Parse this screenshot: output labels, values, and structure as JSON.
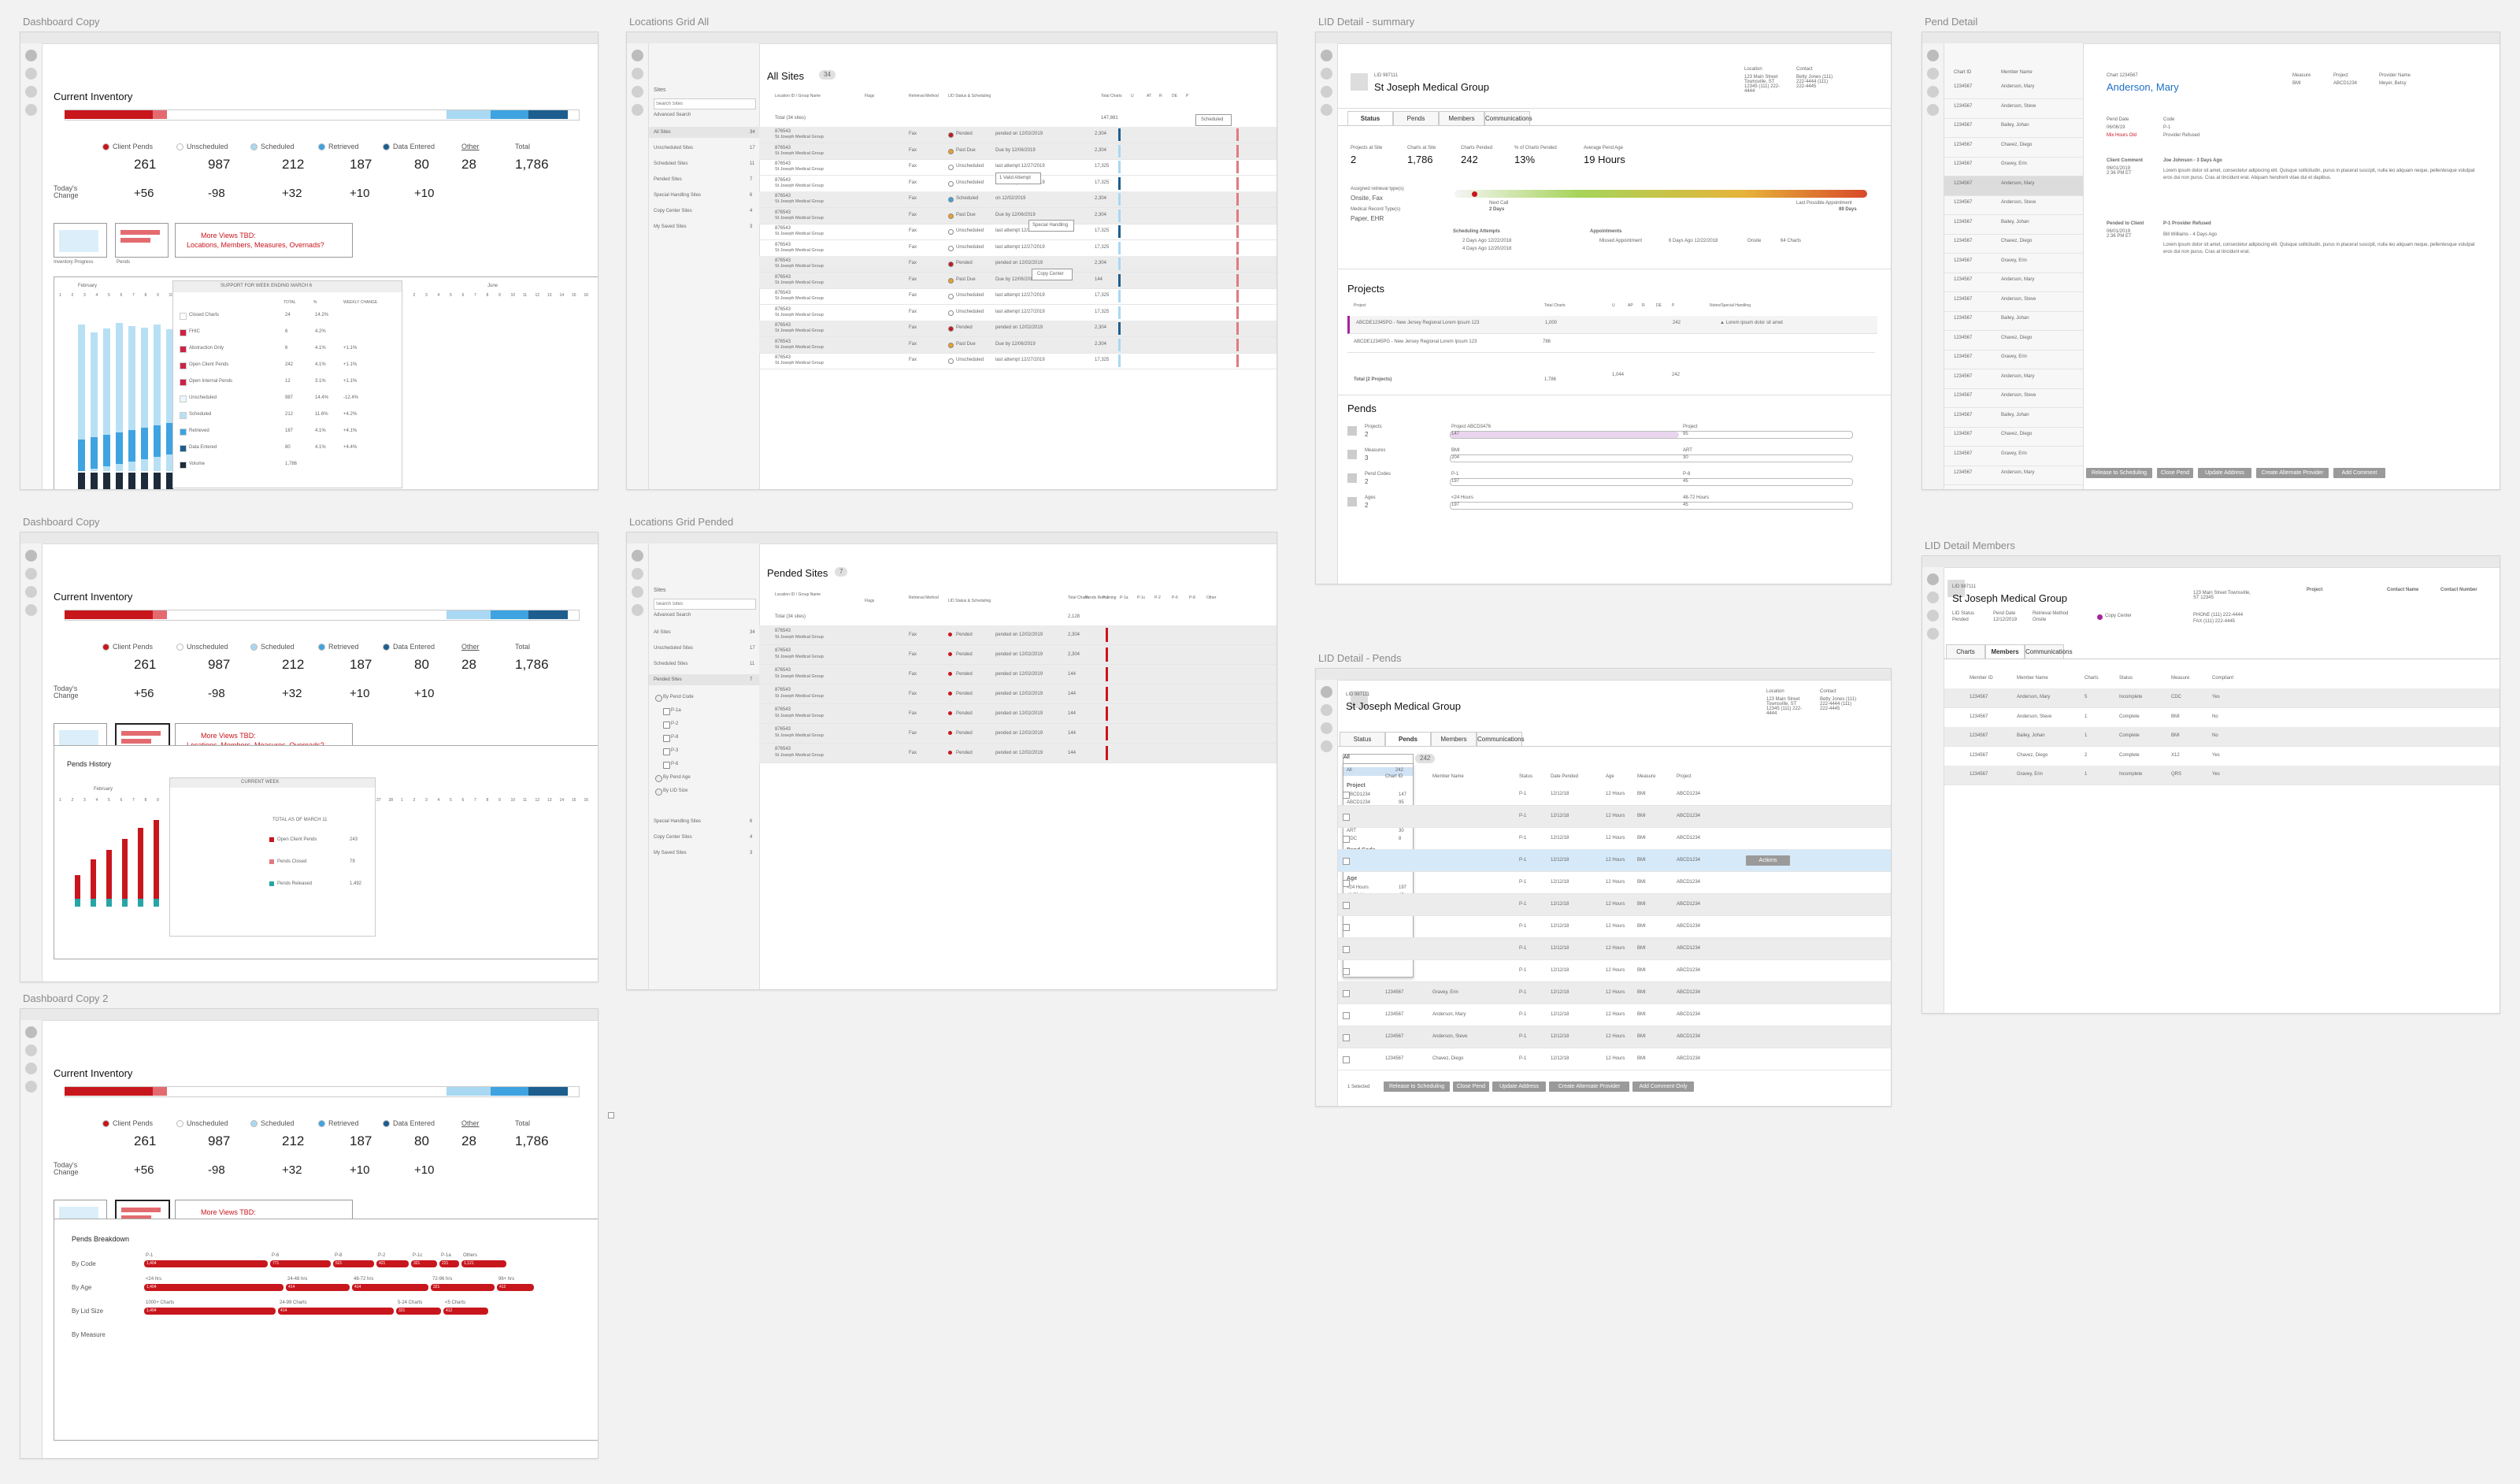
{
  "artboards": {
    "dash1": "Dashboard Copy",
    "locations_all": "Locations Grid All",
    "lid_summary": "LID Detail - summary",
    "pend_detail": "Pend Detail",
    "dash2": "Dashboard Copy",
    "locations_pended": "Locations Grid Pended",
    "lid_pends": "LID Detail - Pends",
    "lid_members": "LID Detail Members",
    "dash3": "Dashboard Copy 2"
  },
  "inventory": {
    "title": "Current Inventory",
    "legend": [
      {
        "label": "Client Pends",
        "color": "#c8161d",
        "value": "261",
        "change": "+56"
      },
      {
        "label": "Unscheduled",
        "color": "#ffffff",
        "value": "987",
        "change": "-98"
      },
      {
        "label": "Scheduled",
        "color": "#a9d8f2",
        "value": "212",
        "change": "+32"
      },
      {
        "label": "Retrieved",
        "color": "#3ea3e0",
        "value": "187",
        "change": "+10"
      },
      {
        "label": "Data Entered",
        "color": "#1d5e8f",
        "value": "80",
        "change": "+10"
      }
    ],
    "other_label": "Other",
    "other_value": "28",
    "total_label": "Total",
    "total_value": "1,786",
    "today_change_label": "Today's Change",
    "more_views": "More Views TBD:",
    "more_views_sub": "Locations, Members, Measures, Overnads?",
    "thumb1": "Inventory Progress",
    "thumb2": "Pends"
  },
  "dash1_chart": {
    "header": "SUPPORT FOR WEEK ENDING MARCH 6",
    "months": [
      "February",
      "March",
      "April",
      "May",
      "June"
    ],
    "cols": [
      "TOTAL",
      "%",
      "WEEKLY CHANGE"
    ],
    "rows": [
      {
        "label": "Closed Charts",
        "total": "24",
        "pct": "14.2%",
        "chg": ""
      },
      {
        "label": "FHIC",
        "total": "6",
        "pct": "4.2%",
        "chg": ""
      },
      {
        "label": "Abstraction Only",
        "total": "6",
        "pct": "4.1%",
        "chg": "+1.1%"
      },
      {
        "label": "Open Client Pends",
        "total": "242",
        "pct": "4.1%",
        "chg": "+1.1%"
      },
      {
        "label": "Open Internal Pends",
        "total": "12",
        "pct": "3.1%",
        "chg": "+1.1%"
      },
      {
        "label": "Unscheduled",
        "total": "987",
        "pct": "14.4%",
        "chg": "-12.4%"
      },
      {
        "label": "Scheduled",
        "total": "212",
        "pct": "11.6%",
        "chg": "+4.2%"
      },
      {
        "label": "Retrieved",
        "total": "187",
        "pct": "4.1%",
        "chg": "+4.1%"
      },
      {
        "label": "Data Entered",
        "total": "80",
        "pct": "4.1%",
        "chg": "+4.4%"
      },
      {
        "label": "Volume",
        "total": "1,786",
        "pct": "",
        "chg": ""
      }
    ]
  },
  "pends_history": {
    "title": "Pends History",
    "current_week": "CURRENT WEEK",
    "total_label": "TOTAL AS OF MARCH 11",
    "items": [
      {
        "label": "Open Client Pends",
        "value": "243",
        "color": "#c8161d"
      },
      {
        "label": "Pends Closed",
        "value": "79",
        "color": "#e07b80"
      },
      {
        "label": "Pends Released",
        "value": "1,492",
        "color": "#27a5a5"
      }
    ],
    "month": "February"
  },
  "pends_breakdown": {
    "title": "Pends Breakdown",
    "rows": [
      {
        "label": "By Code",
        "segs": [
          {
            "h": "P-1",
            "v": "1,404"
          },
          {
            "h": "P-6",
            "v": "771"
          },
          {
            "h": "P-8",
            "v": "521"
          },
          {
            "h": "P-2",
            "v": "421"
          },
          {
            "h": "P-1c",
            "v": "321"
          },
          {
            "h": "P-1a",
            "v": "221"
          },
          {
            "h": "Others",
            "v": "1,121"
          }
        ]
      },
      {
        "label": "By Age",
        "segs": [
          {
            "h": "<24 hrs",
            "v": "1,404"
          },
          {
            "h": "24-48 hrs",
            "v": "414"
          },
          {
            "h": "48-72 hrs",
            "v": "414"
          },
          {
            "h": "72-96 hrs",
            "v": "321"
          },
          {
            "h": "96+ hrs",
            "v": "412"
          }
        ]
      },
      {
        "label": "By Lid Size",
        "segs": [
          {
            "h": "1000+ Charts",
            "v": "1,404"
          },
          {
            "h": "24-99 Charts",
            "v": "414"
          },
          {
            "h": "5-24 Charts",
            "v": "321"
          },
          {
            "h": "<5 Charts",
            "v": "412"
          }
        ]
      },
      {
        "label": "By Measure",
        "segs": []
      }
    ]
  },
  "locations": {
    "sites_label": "Sites",
    "search_placeholder": "Search Sites",
    "advanced_search": "Advanced Search",
    "all_sites_title": "All Sites",
    "all_sites_count": "34",
    "pended_title": "Pended Sites",
    "pended_count": "7",
    "sidebar": [
      {
        "label": "All Sites",
        "count": "34"
      },
      {
        "label": "Unscheduled Sites",
        "count": "17"
      },
      {
        "label": "Scheduled Sites",
        "count": "11"
      },
      {
        "label": "Pended Sites",
        "count": "7"
      },
      {
        "label": "Special Handling Sites",
        "count": "6"
      },
      {
        "label": "Copy Center Sites",
        "count": "4"
      },
      {
        "label": "My Saved Sites",
        "count": "3"
      }
    ],
    "pend_filters": [
      "By Pend Code",
      "P-1a",
      "P-2",
      "P-8",
      "P-3",
      "P-6",
      "By Pend Age",
      "By LID Size"
    ],
    "columns": [
      "Location ID / Group Name",
      "Flags",
      "Retrieval Method",
      "LID Status & Scheduling",
      "Total Charts",
      "U",
      "AT",
      "R",
      "DE",
      "P"
    ],
    "totals": "Total (34 sites)",
    "total_charts": "147,881",
    "site_id": "876543",
    "site_name": "St Joseph Medical Group",
    "method": "Fax",
    "statuses": [
      {
        "status": "Pended",
        "color": "#c8161d",
        "note": "pended on 12/02/2019",
        "charts": "2,304"
      },
      {
        "status": "Past Due",
        "color": "#f0a020",
        "note": "Due by 12/06/2019",
        "charts": "2,304"
      },
      {
        "status": "Unscheduled",
        "color": "#ffffff",
        "note": "last attempt 12/27/2019",
        "charts": "17,325"
      },
      {
        "status": "Unscheduled",
        "color": "#ffffff",
        "note": "last attempt 12/27/2019",
        "charts": "17,325"
      },
      {
        "status": "Scheduled",
        "color": "#3ea3e0",
        "note": "on 12/02/2019",
        "charts": "2,304"
      },
      {
        "status": "Past Due",
        "color": "#f0a020",
        "note": "Due by 12/06/2019",
        "charts": "2,304"
      },
      {
        "status": "Unscheduled",
        "color": "#ffffff",
        "note": "last attempt 12/27/2019",
        "charts": "17,325"
      },
      {
        "status": "Unscheduled",
        "color": "#ffffff",
        "note": "last attempt 12/27/2019",
        "charts": "17,325"
      },
      {
        "status": "Pended",
        "color": "#c8161d",
        "note": "pended on 12/02/2019",
        "charts": "2,304"
      },
      {
        "status": "Past Due",
        "color": "#f0a020",
        "note": "Due by 12/06/2019",
        "charts": "144"
      },
      {
        "status": "Unscheduled",
        "color": "#ffffff",
        "note": "last attempt 12/27/2019",
        "charts": "17,325"
      },
      {
        "status": "Unscheduled",
        "color": "#ffffff",
        "note": "last attempt 12/27/2019",
        "charts": "17,325"
      },
      {
        "status": "Pended",
        "color": "#c8161d",
        "note": "pended on 12/02/2019",
        "charts": "2,304"
      },
      {
        "status": "Past Due",
        "color": "#f0a020",
        "note": "Due by 12/06/2019",
        "charts": "2,304"
      },
      {
        "status": "Unscheduled",
        "color": "#ffffff",
        "note": "last attempt 12/27/2019",
        "charts": "17,325"
      }
    ],
    "tooltip_scheduled": "Scheduled",
    "tooltip_failed": "1 Valid Attempt",
    "tooltip_special": "Special Handling",
    "tooltip_copy": "Copy Center",
    "pended_rows": [
      {
        "note": "pended on 12/02/2019",
        "charts": "2,304"
      },
      {
        "note": "pended on 12/02/2019",
        "charts": "2,304"
      },
      {
        "note": "pended on 12/02/2019",
        "charts": "144"
      },
      {
        "note": "pended on 12/02/2019",
        "charts": "144"
      },
      {
        "note": "pended on 12/02/2019",
        "charts": "144"
      },
      {
        "note": "pended on 12/02/2019",
        "charts": "144"
      },
      {
        "note": "pended on 12/02/2019",
        "charts": "144"
      }
    ],
    "pended_cols": [
      "Total Charts",
      "Pends Remaining",
      "P-1",
      "P-1a",
      "P-1c",
      "P-2",
      "P-6",
      "P-8",
      "Other"
    ],
    "pended_total": "2,128"
  },
  "lid": {
    "lid_no": "LID 987111",
    "name": "St Joseph Medical Group",
    "address_label": "Location",
    "address": "123 Main Street Townsville, ST 12345 (111) 222-4444",
    "contact_label": "Contact",
    "contact": "Betty Jones (111) 222-4444 (111) 222-4445",
    "tabs": [
      "Status",
      "Pends",
      "Members",
      "Communications"
    ],
    "stats": [
      {
        "label": "Projects at Site",
        "value": "2"
      },
      {
        "label": "Charts at Site",
        "value": "1,786"
      },
      {
        "label": "Charts Pended",
        "value": "242"
      },
      {
        "label": "% of Charts Pended",
        "value": "13%"
      },
      {
        "label": "Average Pend Age",
        "value": "19 Hours"
      }
    ],
    "retrieval_label": "Assigned retrieval type(s)",
    "retrieval": "Onsite, Fax",
    "records_label": "Medical Record Type(s)",
    "records": "Paper, EHR",
    "next_call": "Next Call",
    "next_call_days": "2 Days",
    "last_appt": "Last Possible Appointment",
    "last_appt_days": "89 Days",
    "sched_attempts": "Scheduling Attempts",
    "attempt1": "2 Days Ago 12/22/2018",
    "attempt2": "4 Days Ago 12/20/2018",
    "appointments": "Appointments",
    "missed": "Missed Appointment",
    "missed_when": "6 Days Ago 12/22/2018",
    "missed_type": "Onsite",
    "missed_charts": "64 Charts",
    "projects_title": "Projects",
    "proj_cols": [
      "Project",
      "Total Charts",
      "U",
      "AP",
      "R",
      "DE",
      "P",
      "Notes/Special Handling"
    ],
    "projects": [
      {
        "name": "ABCDE12345PG - New Jersey Regional Lorem Ipsum 123",
        "charts": "1,000",
        "p": "242",
        "note": "Lorem ipsum dolor sit amet"
      },
      {
        "name": "ABCDE12345PG - New Jersey Regional Lorem Ipsum 123",
        "charts": "786",
        "p": "",
        "note": ""
      }
    ],
    "proj_total": "Total (2 Projects)",
    "proj_total_charts": "1,786",
    "proj_total_u": "1,044",
    "proj_total_p": "242",
    "pends_title": "Pends",
    "pend_rows": [
      {
        "label": "Projects",
        "value": "2",
        "a": "Project ABCD3476",
        "av": "147",
        "b": "Project",
        "bv": "95"
      },
      {
        "label": "Measures",
        "value": "3",
        "a": "BMI",
        "av": "204",
        "b": "ART",
        "bv": "30"
      },
      {
        "label": "Pend Codes",
        "value": "2",
        "a": "P-1",
        "av": "197",
        "b": "P-8",
        "bv": "45"
      },
      {
        "label": "Ages",
        "value": "2",
        "a": "<24 Hours",
        "av": "197",
        "b": "48-72 Hours",
        "bv": "45"
      }
    ]
  },
  "lid_pends": {
    "filter": "All",
    "count": "242",
    "cols": [
      "Chart ID",
      "Member Name",
      "Status",
      "Date Pended",
      "Age",
      "Measure",
      "Project"
    ],
    "facets": [
      {
        "title": "Project",
        "items": [
          {
            "l": "ABCD1234",
            "v": "147"
          },
          {
            "l": "ABCD1234",
            "v": "95"
          }
        ]
      },
      {
        "title": "Measure",
        "items": [
          {
            "l": "BMI",
            "v": "204"
          },
          {
            "l": "ART",
            "v": "30"
          },
          {
            "l": "CDC",
            "v": "8"
          }
        ]
      },
      {
        "title": "Pend Code",
        "items": [
          {
            "l": "P-1",
            "v": "197"
          },
          {
            "l": "P-8",
            "v": "45"
          }
        ]
      },
      {
        "title": "Age",
        "items": [
          {
            "l": "<24 Hours",
            "v": "197"
          },
          {
            "l": "48-72 Hours",
            "v": "45"
          }
        ]
      }
    ],
    "rows": [
      {
        "id": "1234567",
        "name": "Chavez, Diego",
        "status": "P-1",
        "date": "12/12/18",
        "age": "12 Hours",
        "measure": "BMI",
        "project": "ABCD1234"
      },
      {
        "id": "1234567",
        "name": "Gravey, Erin",
        "status": "P-1",
        "date": "12/12/18",
        "age": "12 Hours",
        "measure": "BMI",
        "project": "ABCD1234"
      },
      {
        "id": "1234567",
        "name": "Anderson, Mary",
        "status": "P-1",
        "date": "12/12/18",
        "age": "12 Hours",
        "measure": "BMI",
        "project": "ABCD1234"
      },
      {
        "id": "1234567",
        "name": "Anderson, Steve",
        "status": "P-1",
        "date": "12/12/18",
        "age": "12 Hours",
        "measure": "BMI",
        "project": "ABCD1234"
      }
    ],
    "actions": "Actions",
    "selected": "1 Selected",
    "buttons": [
      "Release to Scheduling",
      "Close Pend",
      "Update Address",
      "Create Alternate Provider",
      "Add Comment Only"
    ]
  },
  "pend_detail": {
    "chart_label": "Chart 1234567",
    "member": "Anderson, Mary",
    "measure_label": "Measure",
    "measure": "BMI",
    "project_label": "Project",
    "project": "ABCD1234",
    "provider_label": "Provider Name",
    "provider": "Meyer, Betsy",
    "pend_date_label": "Pend Date",
    "pend_date": "06/06/19",
    "pend_age": "Mix Hours Old",
    "code_label": "Code",
    "code": "P-1",
    "code_desc": "Provider Refused",
    "client_comment": "Client Comment",
    "commenter": "Joe Johnson - 3 Days Ago",
    "comment_date": "06/01/2019 2:36 PM ET",
    "comment_body": "Lorem ipsum dolor sit amet, consectetur adipiscing elit. Quisque sollicitudin, purus in placerat suscipit, nulla leo aliquam neque, pellentesque volutpat eros dui non purus. Cras at tincidunt erat. Aliquam hendrerit vitae dui et dapibus.",
    "pended_label": "Pended to Client",
    "pended_date": "06/01/2019 2:36 PM ET",
    "pended_title": "P-1 Provider Refused",
    "pended_by": "Bill Williams - 4 Days Ago",
    "pended_body": "Lorem ipsum dolor sit amet, consectetur adipiscing elit. Quisque sollicitudin, purus in placerat suscipit, nulla leo aliquam neque, pellentesque volutpat eros dui non purus. Cras at tincidunt erat.",
    "list_cols": [
      "Chart ID",
      "Member Name"
    ],
    "list": [
      {
        "id": "1234567",
        "name": "Anderson, Mary"
      },
      {
        "id": "1234567",
        "name": "Anderson, Steve"
      },
      {
        "id": "1234567",
        "name": "Bailey, Johan"
      },
      {
        "id": "1234567",
        "name": "Chavez, Diego"
      },
      {
        "id": "1234567",
        "name": "Gravey, Erin"
      },
      {
        "id": "1234567",
        "name": "Anderson, Mary"
      },
      {
        "id": "1234567",
        "name": "Anderson, Steve"
      },
      {
        "id": "1234567",
        "name": "Bailey, Johan"
      },
      {
        "id": "1234567",
        "name": "Chavez, Diego"
      },
      {
        "id": "1234567",
        "name": "Gravey, Erin"
      },
      {
        "id": "1234567",
        "name": "Anderson, Mary"
      },
      {
        "id": "1234567",
        "name": "Anderson, Steve"
      },
      {
        "id": "1234567",
        "name": "Bailey, Johan"
      },
      {
        "id": "1234567",
        "name": "Chavez, Diego"
      },
      {
        "id": "1234567",
        "name": "Gravey, Erin"
      },
      {
        "id": "1234567",
        "name": "Anderson, Mary"
      },
      {
        "id": "1234567",
        "name": "Anderson, Steve"
      },
      {
        "id": "1234567",
        "name": "Bailey, Johan"
      },
      {
        "id": "1234567",
        "name": "Chavez, Diego"
      },
      {
        "id": "1234567",
        "name": "Gravey, Erin"
      },
      {
        "id": "1234567",
        "name": "Anderson, Mary"
      }
    ],
    "buttons": [
      "Release to Scheduling",
      "Close Pend",
      "Update Address",
      "Create Alternate Provider",
      "Add Comment"
    ]
  },
  "members": {
    "lid_no": "LID 987111",
    "name": "St Joseph Medical Group",
    "status_label": "LID Status",
    "status": "Pended",
    "pend_date_label": "Pend Date",
    "pend_date": "12/12/2019",
    "retrieval_label": "Retrieval Method",
    "retrieval": "Onsite",
    "copy_center": "Copy Center",
    "address": "123 Main Street Townsville, ST 12345",
    "phone": "PHONE (111) 222-4444",
    "fax": "FAX (111) 222-4445",
    "project_label": "Project",
    "contact_label": "Contact Name",
    "number_label": "Contact Number",
    "tabs": [
      "Charts",
      "Members",
      "Communications"
    ],
    "cols": [
      "Member ID",
      "Member Name",
      "Charts",
      "Status",
      "Measure",
      "Compliant"
    ],
    "rows": [
      {
        "id": "1234567",
        "name": "Anderson, Mary",
        "charts": "5",
        "status": "Incomplete",
        "measure": "CDC",
        "compliant": "Yes"
      },
      {
        "id": "1234567",
        "name": "Anderson, Steve",
        "charts": "1",
        "status": "Complete",
        "measure": "BMI",
        "compliant": "No"
      },
      {
        "id": "1234567",
        "name": "Bailey, Johan",
        "charts": "1",
        "status": "Complete",
        "measure": "BMI",
        "compliant": "No"
      },
      {
        "id": "1234567",
        "name": "Chavez, Diego",
        "charts": "2",
        "status": "Complete",
        "measure": "X12",
        "compliant": "Yes"
      },
      {
        "id": "1234567",
        "name": "Gravey, Erin",
        "charts": "1",
        "status": "Incomplete",
        "measure": "QRS",
        "compliant": "Yes"
      }
    ]
  }
}
